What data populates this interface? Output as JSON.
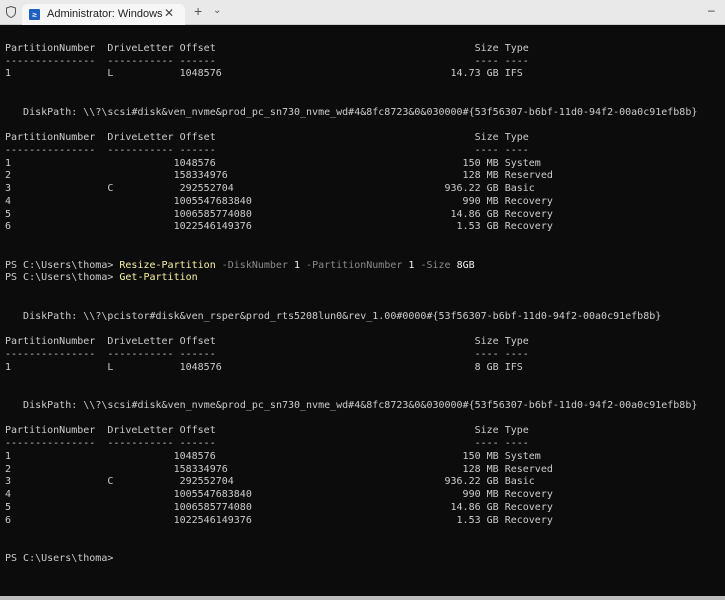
{
  "window": {
    "tab_title": "Administrator: Windows PowerShell",
    "tab_close": "✕",
    "new_tab": "+",
    "dropdown": "⌄",
    "minimize": "–",
    "icon_glyph": "≥"
  },
  "colors": {
    "background": "#0c0c0c",
    "text": "#cccccc",
    "command": "#f9f1a5",
    "parameter": "#8a8a8a"
  },
  "table_headers": {
    "columns": [
      "PartitionNumber",
      "DriveLetter",
      "Offset",
      "Size",
      "Type"
    ],
    "dashes": [
      "---------------",
      "-----------",
      "------",
      "----",
      "----"
    ]
  },
  "blocks": [
    {
      "kind": "blank"
    },
    {
      "kind": "table",
      "rows": [
        {
          "number": "1",
          "drive": "L",
          "offset": "1048576",
          "size": "14.73 GB",
          "type": "IFS"
        }
      ]
    },
    {
      "kind": "blank"
    },
    {
      "kind": "blank"
    },
    {
      "kind": "diskpath",
      "label": "DiskPath:",
      "value": "\\\\?\\scsi#disk&ven_nvme&prod_pc_sn730_nvme_wd#4&8fc8723&0&030000#{53f56307-b6bf-11d0-94f2-00a0c91efb8b}"
    },
    {
      "kind": "blank"
    },
    {
      "kind": "table",
      "rows": [
        {
          "number": "1",
          "drive": "",
          "offset": "1048576",
          "size": "150 MB",
          "type": "System"
        },
        {
          "number": "2",
          "drive": "",
          "offset": "158334976",
          "size": "128 MB",
          "type": "Reserved"
        },
        {
          "number": "3",
          "drive": "C",
          "offset": "292552704",
          "size": "936.22 GB",
          "type": "Basic"
        },
        {
          "number": "4",
          "drive": "",
          "offset": "1005547683840",
          "size": "990 MB",
          "type": "Recovery"
        },
        {
          "number": "5",
          "drive": "",
          "offset": "1006585774080",
          "size": "14.86 GB",
          "type": "Recovery"
        },
        {
          "number": "6",
          "drive": "",
          "offset": "1022546149376",
          "size": "1.53 GB",
          "type": "Recovery"
        }
      ]
    },
    {
      "kind": "blank"
    },
    {
      "kind": "blank"
    },
    {
      "kind": "command",
      "segments": [
        {
          "text": "PS C:\\Users\\thoma> ",
          "role": "prompt"
        },
        {
          "text": "Resize-Partition",
          "role": "cmd"
        },
        {
          "text": " -DiskNumber ",
          "role": "param"
        },
        {
          "text": "1",
          "role": "val"
        },
        {
          "text": " -PartitionNumber ",
          "role": "param"
        },
        {
          "text": "1",
          "role": "val"
        },
        {
          "text": " -Size ",
          "role": "param"
        },
        {
          "text": "8GB",
          "role": "val"
        }
      ]
    },
    {
      "kind": "command",
      "segments": [
        {
          "text": "PS C:\\Users\\thoma> ",
          "role": "prompt"
        },
        {
          "text": "Get-Partition",
          "role": "cmd"
        }
      ]
    },
    {
      "kind": "blank"
    },
    {
      "kind": "blank"
    },
    {
      "kind": "diskpath",
      "label": "DiskPath:",
      "value": "\\\\?\\pcistor#disk&ven_rsper&prod_rts5208lun0&rev_1.00#0000#{53f56307-b6bf-11d0-94f2-00a0c91efb8b}"
    },
    {
      "kind": "blank"
    },
    {
      "kind": "table",
      "rows": [
        {
          "number": "1",
          "drive": "L",
          "offset": "1048576",
          "size": "8 GB",
          "type": "IFS"
        }
      ]
    },
    {
      "kind": "blank"
    },
    {
      "kind": "blank"
    },
    {
      "kind": "diskpath",
      "label": "DiskPath:",
      "value": "\\\\?\\scsi#disk&ven_nvme&prod_pc_sn730_nvme_wd#4&8fc8723&0&030000#{53f56307-b6bf-11d0-94f2-00a0c91efb8b}"
    },
    {
      "kind": "blank"
    },
    {
      "kind": "table",
      "rows": [
        {
          "number": "1",
          "drive": "",
          "offset": "1048576",
          "size": "150 MB",
          "type": "System"
        },
        {
          "number": "2",
          "drive": "",
          "offset": "158334976",
          "size": "128 MB",
          "type": "Reserved"
        },
        {
          "number": "3",
          "drive": "C",
          "offset": "292552704",
          "size": "936.22 GB",
          "type": "Basic"
        },
        {
          "number": "4",
          "drive": "",
          "offset": "1005547683840",
          "size": "990 MB",
          "type": "Recovery"
        },
        {
          "number": "5",
          "drive": "",
          "offset": "1006585774080",
          "size": "14.86 GB",
          "type": "Recovery"
        },
        {
          "number": "6",
          "drive": "",
          "offset": "1022546149376",
          "size": "1.53 GB",
          "type": "Recovery"
        }
      ]
    },
    {
      "kind": "blank"
    },
    {
      "kind": "blank"
    },
    {
      "kind": "command",
      "segments": [
        {
          "text": "PS C:\\Users\\thoma>",
          "role": "prompt"
        }
      ]
    }
  ]
}
